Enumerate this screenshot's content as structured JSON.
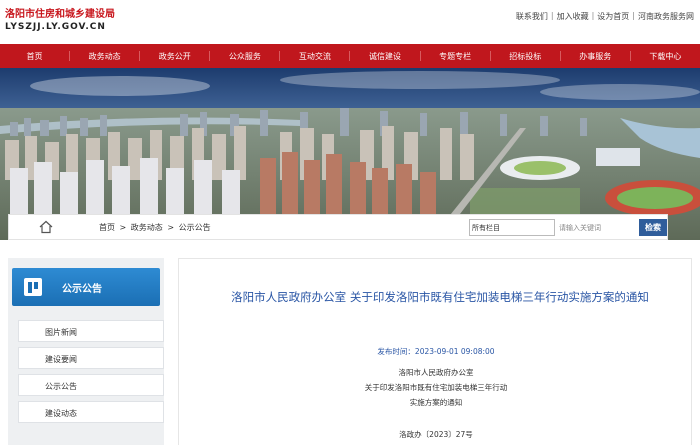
{
  "header": {
    "logo_cn": "洛阳市住房和城乡建设局",
    "logo_en": "LYSZJJ.LY.GOV.CN",
    "top_links": [
      "联系我们",
      "加入收藏",
      "设为首页",
      "河南政务服务网"
    ]
  },
  "nav": {
    "items": [
      "首页",
      "政务动态",
      "政务公开",
      "公众服务",
      "互动交流",
      "诚信建设",
      "专题专栏",
      "招标投标",
      "办事服务",
      "下载中心"
    ]
  },
  "breadcrumb": {
    "items": [
      "首页",
      ">",
      "政务动态",
      ">",
      "公示公告"
    ],
    "search_scope": "所有栏目",
    "search_placeholder": "请输入关键词",
    "search_button": "检索"
  },
  "sidebar": {
    "title": "公示公告",
    "items": [
      "图片新闻",
      "建设要闻",
      "公示公告",
      "建设动态"
    ]
  },
  "article": {
    "title": "洛阳市人民政府办公室 关于印发洛阳市既有住宅加装电梯三年行动实施方案的通知",
    "publish_label": "发布时间：",
    "publish_time": "2023-09-01 09:08:00",
    "body_lines": [
      "洛阳市人民政府办公室",
      "关于印发洛阳市既有住宅加装电梯三年行动",
      "实施方案的通知",
      "洛政办〔2023〕27号"
    ]
  },
  "colors": {
    "nav_red": "#c0171d",
    "accent_blue": "#2a56a5",
    "sidebar_blue": "#1b6fb4"
  }
}
